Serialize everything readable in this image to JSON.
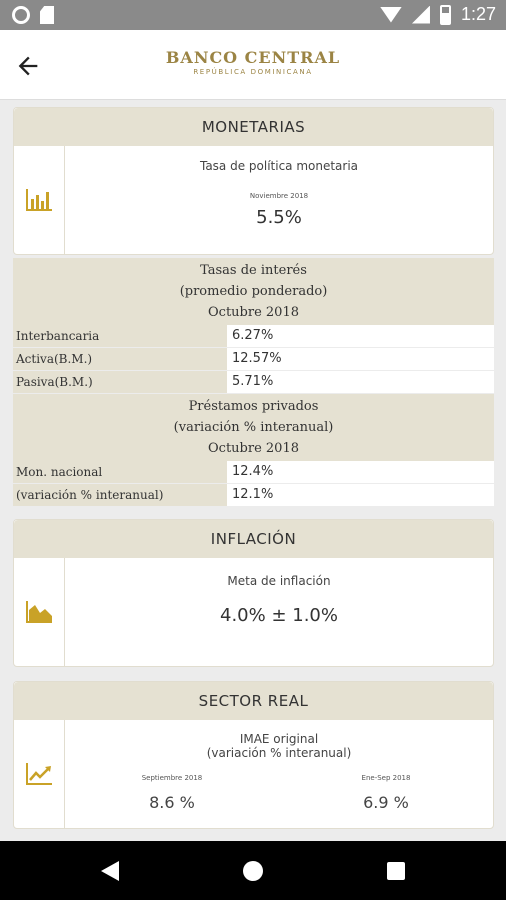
{
  "status": {
    "time": "1:27"
  },
  "header": {
    "brand": "BANCO CENTRAL",
    "subbrand": "REPÚBLICA DOMINICANA"
  },
  "monetarias": {
    "title": "MONETARIAS",
    "policy_label": "Tasa de política monetaria",
    "policy_date": "Noviembre 2018",
    "policy_value": "5.5%",
    "rates_head": [
      "Tasas de interés",
      "(promedio ponderado)",
      "Octubre 2018"
    ],
    "rates": [
      {
        "label": "Interbancaria",
        "value": "6.27%"
      },
      {
        "label": "Activa(B.M.)",
        "value": "12.57%"
      },
      {
        "label": "Pasiva(B.M.)",
        "value": "5.71%"
      }
    ],
    "loans_head": [
      "Préstamos privados",
      "(variación % interanual)",
      "Octubre 2018"
    ],
    "loans": [
      {
        "label": "Mon. nacional",
        "value": "12.4%"
      },
      {
        "label": "(variación % interanual)",
        "value": "12.1%"
      }
    ]
  },
  "inflacion": {
    "title": "INFLACIÓN",
    "label": "Meta de inflación",
    "value": "4.0% ± 1.0%"
  },
  "sector_real": {
    "title": "SECTOR REAL",
    "label1": "IMAE original",
    "label2": "(variación % interanual)",
    "left_period": "Septiembre 2018",
    "left_value": "8.6 %",
    "right_period": "Ene-Sep 2018",
    "right_value": "6.9 %"
  },
  "icons": {
    "back": "arrow-back-icon",
    "chart": "bar-chart-icon",
    "area": "area-chart-icon",
    "trend": "trend-chart-icon"
  },
  "colors": {
    "accent": "#c9a227",
    "header_bg": "#e5e1d2",
    "brand": "#9b8444"
  }
}
